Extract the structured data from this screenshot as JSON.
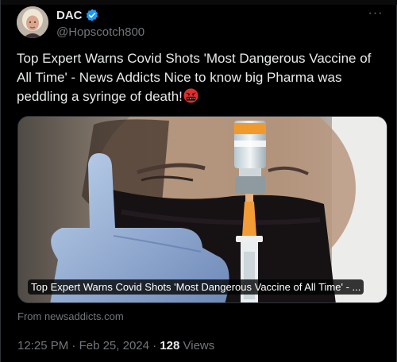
{
  "author": {
    "display_name": "DAC",
    "handle": "@Hopscotch800",
    "verified": true
  },
  "tweet": {
    "text": "Top Expert Warns Covid Shots 'Most Dangerous Vaccine of All Time' - News Addicts  Nice to know big Pharma was peddling a syringe of death!",
    "emoji": "angry-swearing-face"
  },
  "link_card": {
    "caption": "Top Expert Warns Covid Shots 'Most Dangerous Vaccine of All Time' - ...",
    "source": "From newsaddicts.com"
  },
  "meta": {
    "time": "12:25 PM",
    "date": "Feb 25, 2024",
    "separator": "·",
    "views_count": "128",
    "views_label": "Views"
  },
  "more_label": "···",
  "colors": {
    "background": "#000000",
    "text": "#e7e9ea",
    "muted": "#71767b",
    "verified": "#1d9bf0",
    "border": "#2f3336"
  }
}
